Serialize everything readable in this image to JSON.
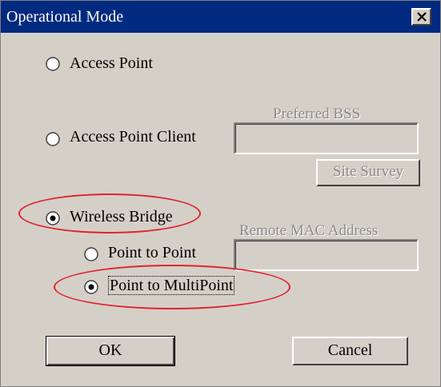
{
  "window": {
    "title": "Operational Mode"
  },
  "modes": {
    "access_point": {
      "label": "Access Point",
      "selected": false
    },
    "access_point_client": {
      "label": "Access Point Client",
      "selected": false
    },
    "wireless_bridge": {
      "label": "Wireless Bridge",
      "selected": true
    }
  },
  "bridge_modes": {
    "point_to_point": {
      "label": "Point to Point",
      "selected": false
    },
    "point_to_multipoint": {
      "label": "Point to MultiPoint",
      "selected": true
    }
  },
  "fields": {
    "preferred_bss": {
      "label": "Preferred BSS",
      "value": "",
      "enabled": false
    },
    "remote_mac": {
      "label": "Remote MAC Address",
      "value": "",
      "enabled": false
    }
  },
  "buttons": {
    "site_survey": "Site Survey",
    "ok": "OK",
    "cancel": "Cancel"
  },
  "colors": {
    "title_bar": "#002a7f",
    "dialog_bg": "#d4d0c8",
    "highlight": "#e0232e",
    "disabled_text": "#8a8a8a"
  }
}
